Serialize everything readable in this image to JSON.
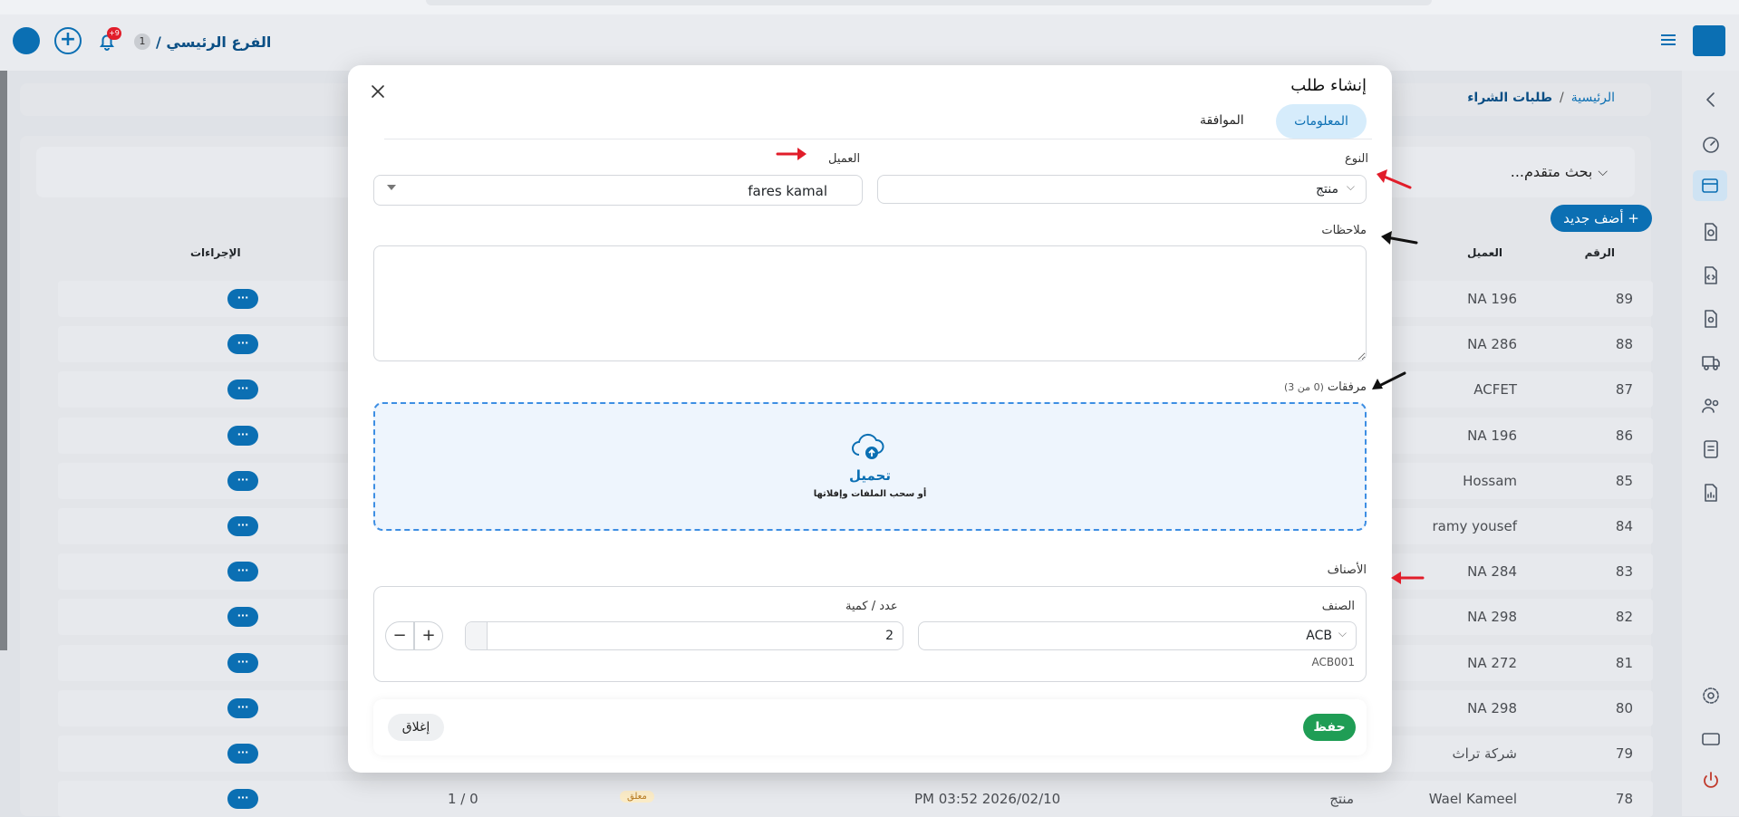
{
  "header": {
    "branch_label": "الفرع الرئيسي /",
    "branch_count": "1",
    "notif_count": "+9"
  },
  "breadcrumb": {
    "home": "الرئيسية",
    "sep": "/",
    "current": "طلبات الشراء"
  },
  "search": {
    "advanced_label": "بحث متقدم..."
  },
  "add_button": "+ أضف جديد",
  "table": {
    "headers": {
      "number": "الرقم",
      "customer": "العميل",
      "actions": "الإجراءات"
    },
    "rows": [
      {
        "number": "89",
        "customer": "NA 196"
      },
      {
        "number": "88",
        "customer": "NA 286"
      },
      {
        "number": "87",
        "customer": "ACFET"
      },
      {
        "number": "86",
        "customer": "NA 196"
      },
      {
        "number": "85",
        "customer": "Hossam"
      },
      {
        "number": "84",
        "customer": "ramy yousef"
      },
      {
        "number": "83",
        "customer": "NA 284"
      },
      {
        "number": "82",
        "customer": "NA 298"
      },
      {
        "number": "81",
        "customer": "NA 272"
      },
      {
        "number": "80",
        "customer": "NA 298"
      },
      {
        "number": "79",
        "customer": "شركة تراث"
      },
      {
        "number": "78",
        "customer": "Wael Kameel",
        "type": "منتج",
        "date": "PM 03:52 2026/02/10",
        "status": "معلق",
        "ratio": "1 / 0"
      }
    ],
    "action_dots": "···"
  },
  "modal": {
    "title": "إنشاء طلب",
    "tabs": {
      "info": "المعلومات",
      "approval": "الموافقة"
    },
    "type_label": "النوع",
    "type_value": "منتج",
    "customer_label": "العميل",
    "customer_value": "fares kamal",
    "notes_label": "ملاحظات",
    "notes_value": "",
    "attachments_label": "مرفقات",
    "attachments_count": "(0 من 3)",
    "upload_title": "تحميل",
    "upload_hint": "أو سحب الملفات وإفلاتها",
    "items_label": "الأصناف",
    "item_col_label": "الصنف",
    "qty_col_label": "عدد / كمية",
    "item_value": "ACB",
    "item_code": "ACB001",
    "qty_value": "2",
    "save_label": "حفظ",
    "close_label": "إغلاق"
  },
  "colors": {
    "primary": "#0b6fb3",
    "save_green": "#1f9d55",
    "tab_active_bg": "#d6ecfb",
    "upload_bg": "#eef5fd",
    "upload_border": "#3d8ee3",
    "arrow_red": "#e11d2a",
    "arrow_black": "#111111"
  }
}
